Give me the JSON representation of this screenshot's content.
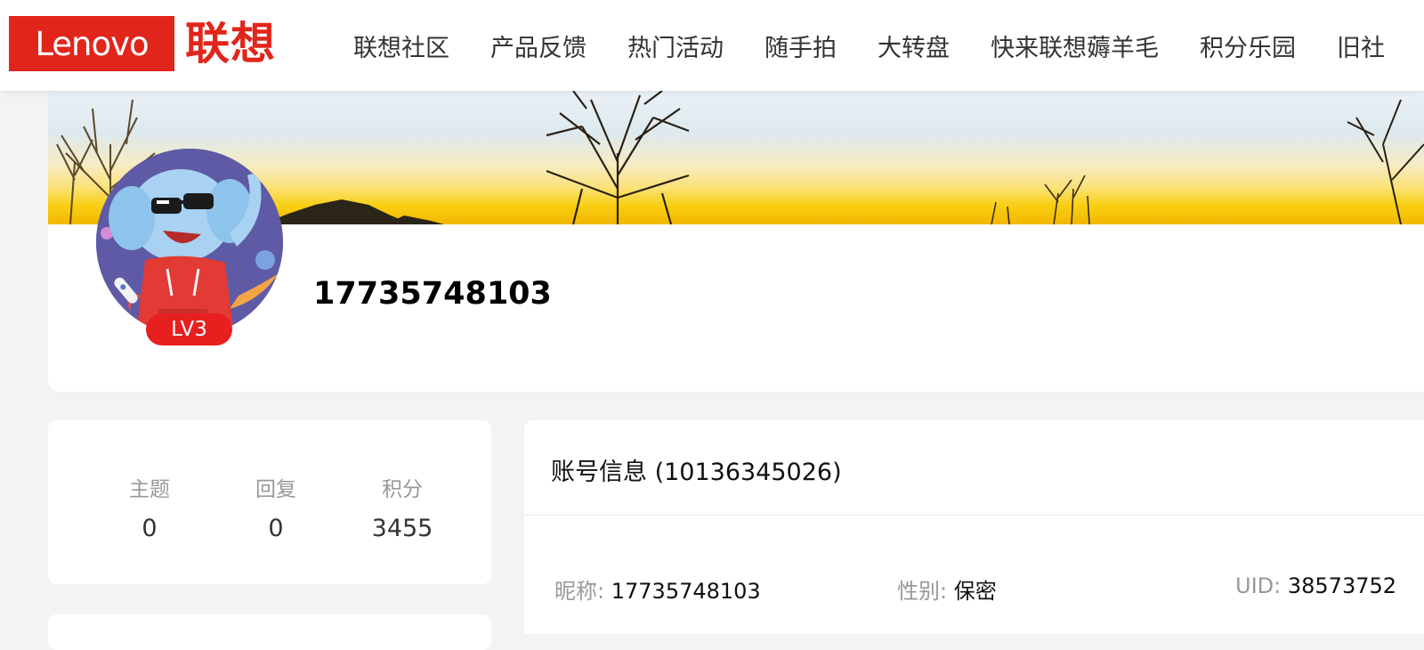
{
  "brand": {
    "logo_en": "Lenovo",
    "logo_cn": "联想",
    "accent": "#e1251b"
  },
  "nav": {
    "items": [
      "联想社区",
      "产品反馈",
      "热门活动",
      "随手拍",
      "大转盘",
      "快来联想薅羊毛",
      "积分乐园",
      "旧社"
    ]
  },
  "profile": {
    "username": "17735748103",
    "level": "LV3"
  },
  "stats": {
    "topics_label": "主题",
    "topics_value": "0",
    "replies_label": "回复",
    "replies_value": "0",
    "points_label": "积分",
    "points_value": "3455"
  },
  "account": {
    "title": "账号信息 (10136345026)",
    "nickname_label": "昵称:",
    "nickname_value": "17735748103",
    "gender_label": "性别:",
    "gender_value": "保密",
    "uid_label": "UID:",
    "uid_value": "38573752"
  },
  "colors": {
    "badge": "#e81f1f",
    "background": "#f3f3f3"
  }
}
